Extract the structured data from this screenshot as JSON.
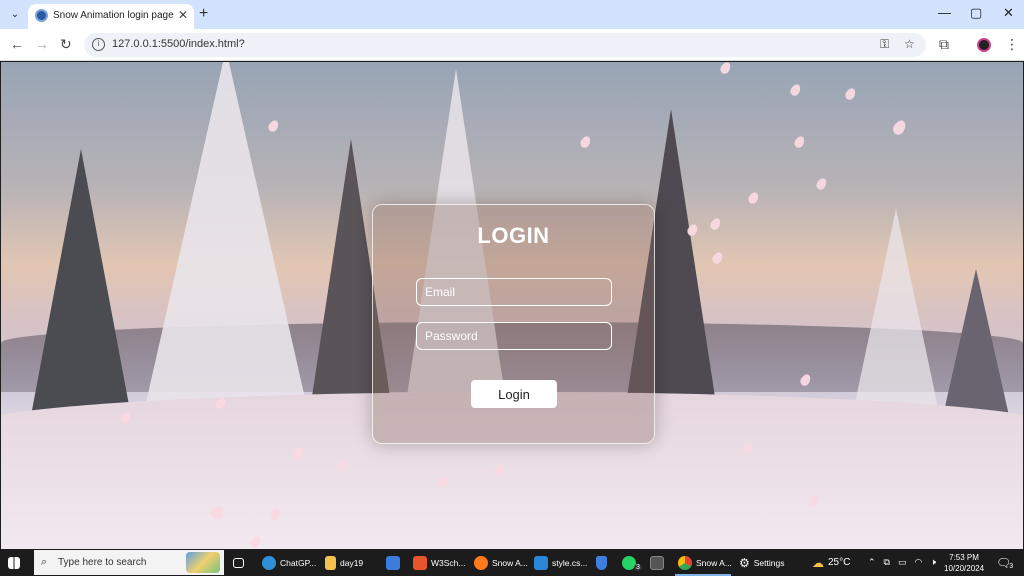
{
  "browser": {
    "tab_title": "Snow Animation login page",
    "url": "127.0.0.1:5500/index.html?",
    "new_tab": "+",
    "tab_close": "✕",
    "tab_dropdown": "⌄",
    "window": {
      "minimize": "—",
      "maximize": "▢",
      "close": "✕"
    },
    "nav": {
      "back": "←",
      "forward": "→",
      "reload": "↻"
    },
    "omnibox_icons": {
      "key": "⚿",
      "bookmark": "☆",
      "extensions": "⧉",
      "menu": "⋮"
    }
  },
  "login": {
    "title": "LOGIN",
    "email_placeholder": "Email",
    "password_placeholder": "Password",
    "button_label": "Login"
  },
  "taskbar": {
    "search_placeholder": "Type here to search",
    "items": [
      {
        "label": "ChatGP...",
        "icon": "edge-icon",
        "color": "#2f8fd8"
      },
      {
        "label": "day19",
        "icon": "folder-icon",
        "color": "#f2c14e"
      },
      {
        "label": "",
        "icon": "store-icon",
        "color": "#3b7ddd"
      },
      {
        "label": "W3Sch...",
        "icon": "brave-icon",
        "color": "#e8552a"
      },
      {
        "label": "Snow A...",
        "icon": "firefox-icon",
        "color": "#ff7a1a"
      },
      {
        "label": "style.cs...",
        "icon": "vscode-icon",
        "color": "#2b88d8"
      },
      {
        "label": "",
        "icon": "shield-icon",
        "color": "#3f7fe0"
      },
      {
        "label": "3",
        "icon": "whatsapp-icon",
        "color": "#25d366"
      },
      {
        "label": "",
        "icon": "terminal-icon",
        "color": "#555555"
      },
      {
        "label": "Snow A...",
        "icon": "chrome-icon",
        "color": "#e5b224"
      },
      {
        "label": "Settings",
        "icon": "gear-icon",
        "color": "#cccccc"
      }
    ],
    "weather": "25°C",
    "time": "7:53 PM",
    "date": "10/20/2024",
    "notification_count": "3"
  }
}
